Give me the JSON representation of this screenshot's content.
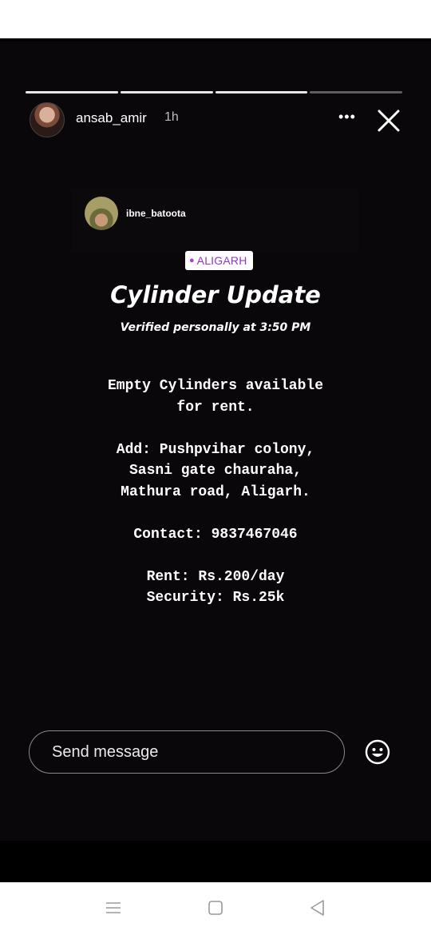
{
  "story": {
    "progress": [
      1,
      1,
      1,
      0
    ],
    "user": {
      "name": "ansab_amir",
      "time": "1h"
    },
    "more_glyph": "•••",
    "close_icon": "close-icon"
  },
  "post": {
    "user": "ibne_batoota",
    "location": "ALIGARH",
    "title": "Cylinder Update",
    "subtitle": "Verified personally at 3:50 PM",
    "lines": [
      "Empty Cylinders available",
      "for rent.",
      "",
      "Add: Pushpvihar colony,",
      "Sasni gate chauraha,",
      "Mathura road, Aligarh.",
      "",
      "Contact: 9837467046",
      "",
      "Rent: Rs.200/day",
      "Security: Rs.25k"
    ]
  },
  "message": {
    "placeholder": "Send message",
    "emoji_icon": "smiley-icon"
  },
  "navbar": {
    "items": [
      "menu-icon",
      "home-square-icon",
      "back-triangle-icon"
    ]
  }
}
